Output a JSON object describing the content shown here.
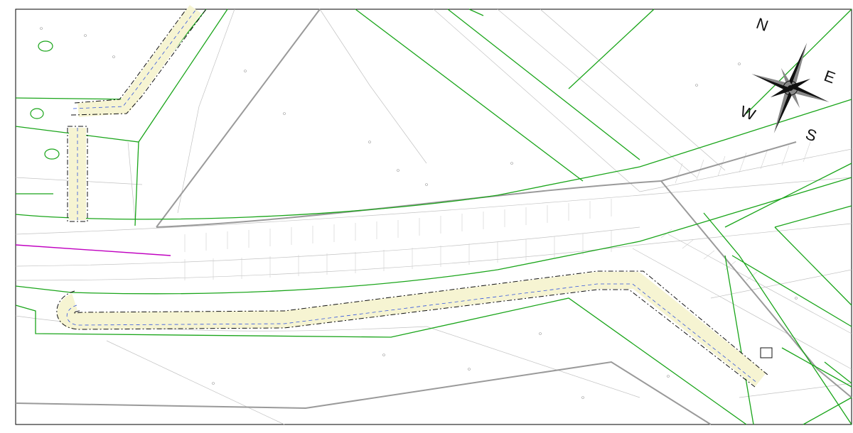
{
  "compass": {
    "north": "N",
    "east": "E",
    "south": "S",
    "west": "W",
    "icon": "compass-rose-icon"
  },
  "colors": {
    "parcel_boundary": "#1aa51a",
    "road_axis": "#9a9a9a",
    "survey_lines": "#b8b8b8",
    "path_fill": "#f6f4d2",
    "path_outline": "#111111",
    "path_centerline": "#3355dd",
    "dimension_text": "#c000c0",
    "trees": "#1aa51a",
    "sheet_frame": "#000000"
  }
}
